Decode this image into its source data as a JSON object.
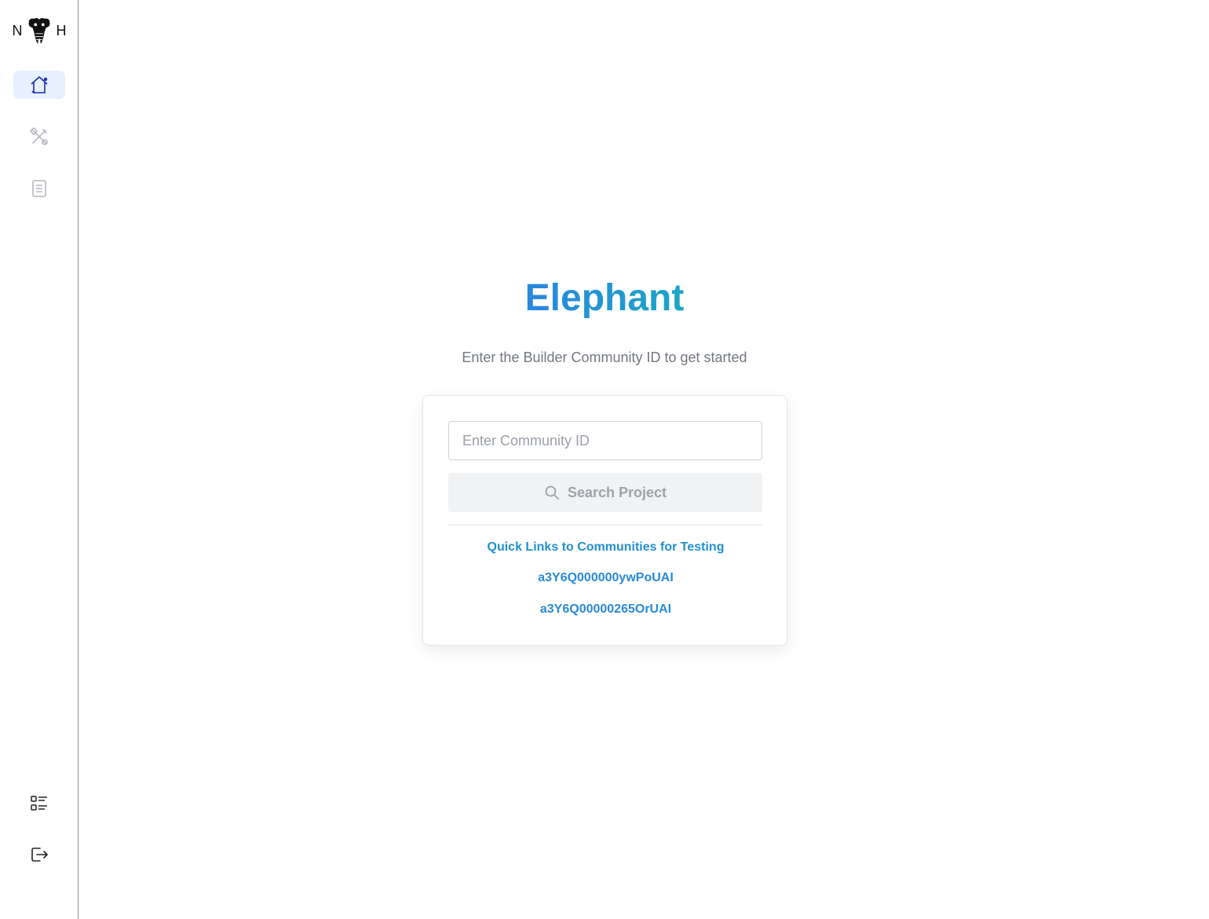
{
  "sidebar": {
    "logo": {
      "left_letter": "N",
      "right_letter": "H",
      "icon": "elephant-logo-icon"
    },
    "nav": [
      {
        "icon": "home-icon",
        "active": true
      },
      {
        "icon": "tools-icon",
        "active": false
      },
      {
        "icon": "document-icon",
        "active": false
      }
    ],
    "bottom": [
      {
        "icon": "list-icon"
      },
      {
        "icon": "logout-icon"
      }
    ]
  },
  "main": {
    "title": "Elephant",
    "subtitle": "Enter the Builder Community ID to get started",
    "search": {
      "placeholder": "Enter Community ID",
      "value": "",
      "button_label": "Search Project",
      "button_icon": "search-icon"
    },
    "quick_links": {
      "title": "Quick Links to Communities for Testing",
      "items": [
        "a3Y6Q000000ywPoUAI",
        "a3Y6Q00000265OrUAI"
      ]
    }
  },
  "colors": {
    "accent": "#2b86e0",
    "accent_teal": "#1aa6c4",
    "active_nav_bg": "#e7f0fd",
    "muted_text": "#727780"
  }
}
